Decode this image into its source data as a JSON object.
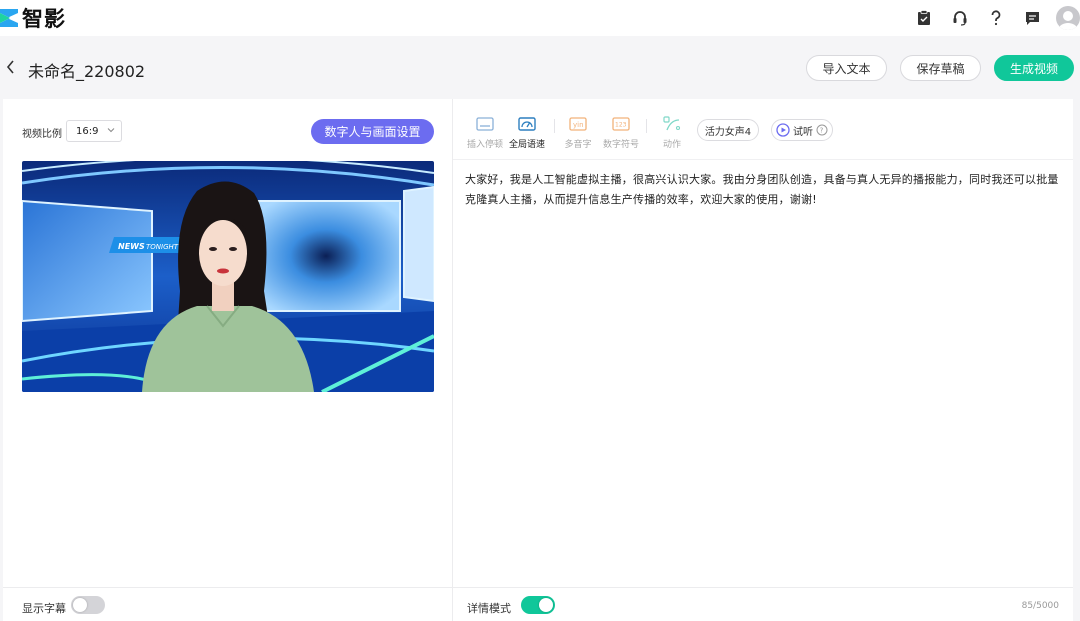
{
  "app": {
    "name": "智影"
  },
  "header_icons": [
    "clipboard-icon",
    "headset-icon",
    "help-icon",
    "message-icon",
    "avatar"
  ],
  "project": {
    "title": "未命名_220802",
    "import_text_label": "导入文本",
    "save_draft_label": "保存草稿",
    "generate_label": "生成视频"
  },
  "left_panel": {
    "ratio_label": "视频比例",
    "ratio_value": "16:9",
    "settings_button_label": "数字人与画面设置",
    "preview": {
      "badge_news": "NEWS",
      "badge_tonight": "TONIGHT"
    },
    "subtitle_label": "显示字幕",
    "subtitle_enabled": false
  },
  "right_panel": {
    "tools": [
      {
        "label": "插入停顿",
        "icon": "pause-insert-icon",
        "state": "disabled"
      },
      {
        "label": "全局语速",
        "icon": "speed-gauge-icon",
        "state": "active"
      },
      {
        "label": "多音字",
        "icon": "polyphone-icon",
        "state": "disabled"
      },
      {
        "label": "数字符号",
        "icon": "number-symbol-icon",
        "state": "disabled"
      },
      {
        "label": "动作",
        "icon": "action-icon",
        "state": "disabled"
      }
    ],
    "voice_label": "活力女声4",
    "listen_label": "试听",
    "script_text": "大家好，我是人工智能虚拟主播，很高兴认识大家。我由分身团队创造，具备与真人无异的播报能力，同时我还可以批量克隆真人主播，从而提升信息生产传播的效率，欢迎大家的使用，谢谢!",
    "detail_mode_label": "详情模式",
    "detail_mode_enabled": true,
    "char_count": "85/5000"
  },
  "colors": {
    "accent_green": "#10c79a",
    "accent_purple": "#6c6cf0",
    "toolbar_blue": "#2d7fbf",
    "toolbar_orange": "#f2b27a"
  }
}
